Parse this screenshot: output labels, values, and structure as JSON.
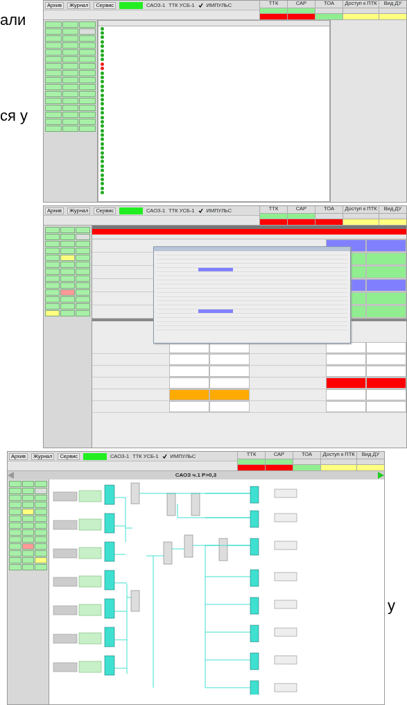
{
  "page_text": [
    "али",
    "ся у",
    "у"
  ],
  "screens": [
    {
      "kind": "table",
      "header": {
        "menu": [
          "Архив",
          "Журнал",
          "Сервис"
        ],
        "unit": "САОЗ-1",
        "device": "ТТК УСБ-1",
        "signal": "ИМПУЛЬС",
        "statuses": [
          {
            "title": "ТТК",
            "cells": [
              {
                "color": "#90ee90"
              },
              {
                "color": "#ff0000"
              }
            ]
          },
          {
            "title": "САР",
            "cells": [
              {
                "color": "#90ee90"
              },
              {
                "color": "#ff0000"
              }
            ]
          },
          {
            "title": "ТОА",
            "cells": [
              {
                "color": "#90ee90"
              }
            ]
          },
          {
            "title": "Доступ к ПТК",
            "cells": [
              {
                "color": "#ffff80"
              }
            ]
          },
          {
            "title": "Вид ДУ",
            "cells": [
              {
                "color": "#ffff80"
              }
            ]
          }
        ]
      },
      "buttons": [
        {
          "color": "#a8f0a8"
        },
        {
          "color": "#a8f0a8"
        },
        {
          "color": "#a8f0a8"
        },
        {
          "color": "#a8f0a8"
        },
        {
          "color": "#a8f0a8"
        },
        {
          "color": "#dddddd"
        },
        {
          "color": "#a8f0a8"
        },
        {
          "color": "#a8f0a8"
        },
        {
          "color": "#a8f0a8"
        },
        {
          "color": "#a8f0a8"
        },
        {
          "color": "#a8f0a8"
        },
        {
          "color": "#a8f0a8"
        },
        {
          "color": "#a8f0a8"
        },
        {
          "color": "#a8f0a8"
        },
        {
          "color": "#a8f0a8"
        },
        {
          "color": "#a8f0a8"
        },
        {
          "color": "#a8f0a8"
        },
        {
          "color": "#a8f0a8"
        },
        {
          "color": "#a8f0a8"
        },
        {
          "color": "#a8f0a8"
        },
        {
          "color": "#a8f0a8"
        },
        {
          "color": "#a8f0a8"
        },
        {
          "color": "#a8f0a8"
        },
        {
          "color": "#a8f0a8"
        },
        {
          "color": "#a8f0a8"
        },
        {
          "color": "#a8f0a8"
        },
        {
          "color": "#a8f0a8"
        },
        {
          "color": "#a8f0a8"
        },
        {
          "color": "#a8f0a8"
        },
        {
          "color": "#a8f0a8"
        },
        {
          "color": "#a8f0a8"
        },
        {
          "color": "#a8f0a8"
        },
        {
          "color": "#a8f0a8"
        },
        {
          "color": "#a8f0a8"
        },
        {
          "color": "#a8f0a8"
        },
        {
          "color": "#a8f0a8"
        },
        {
          "color": "#a8f0a8"
        },
        {
          "color": "#a8f0a8"
        },
        {
          "color": "#a8f0a8"
        },
        {
          "color": "#a8f0a8"
        },
        {
          "color": "#a8f0a8"
        },
        {
          "color": "#a8f0a8"
        },
        {
          "color": "#a8f0a8"
        },
        {
          "color": "#a8f0a8"
        },
        {
          "color": "#a8f0a8"
        },
        {
          "color": "#a8f0a8"
        },
        {
          "color": "#a8f0a8"
        },
        {
          "color": "#a8f0a8"
        }
      ],
      "rows": [
        {
          "color": "#22aa22"
        },
        {
          "color": "#22aa22"
        },
        {
          "color": "#22aa22"
        },
        {
          "color": "#22aa22"
        },
        {
          "color": "#22aa22"
        },
        {
          "color": "#22aa22"
        },
        {
          "color": "#22aa22"
        },
        {
          "color": "#22aa22"
        },
        {
          "color": "#ee2222"
        },
        {
          "color": "#ee2222"
        },
        {
          "color": "#22aa22"
        },
        {
          "color": "#22aa22"
        },
        {
          "color": "#22aa22"
        },
        {
          "color": "#22aa22"
        },
        {
          "color": "#22aa22"
        },
        {
          "color": "#22aa22"
        },
        {
          "color": "#22aa22"
        },
        {
          "color": "#22aa22"
        },
        {
          "color": "#22aa22"
        },
        {
          "color": "#22aa22"
        },
        {
          "color": "#22aa22"
        },
        {
          "color": "#22aa22"
        },
        {
          "color": "#22aa22"
        },
        {
          "color": "#22aa22"
        },
        {
          "color": "#22aa22"
        },
        {
          "color": "#22aa22"
        },
        {
          "color": "#22aa22"
        },
        {
          "color": "#22aa22"
        },
        {
          "color": "#22aa22"
        },
        {
          "color": "#22aa22"
        },
        {
          "color": "#22aa22"
        },
        {
          "color": "#22aa22"
        },
        {
          "color": "#22aa22"
        },
        {
          "color": "#22aa22"
        },
        {
          "color": "#22aa22"
        },
        {
          "color": "#22aa22"
        },
        {
          "color": "#22aa22"
        },
        {
          "color": "#22aa22"
        }
      ]
    },
    {
      "kind": "form",
      "header": {
        "menu": [
          "Архив",
          "Журнал",
          "Сервис"
        ],
        "unit": "САОЗ-1",
        "device": "ТТК УСБ-1",
        "signal": "ИМПУЛЬС",
        "statuses": [
          {
            "title": "ТТК",
            "cells": [
              {
                "color": "#90ee90"
              },
              {
                "color": "#ff0000"
              }
            ]
          },
          {
            "title": "САР",
            "cells": [
              {
                "color": "#90ee90"
              },
              {
                "color": "#ff0000"
              }
            ]
          },
          {
            "title": "ТОА",
            "cells": [
              {
                "color": "#ff0000"
              }
            ]
          },
          {
            "title": "Доступ к ПТК",
            "cells": [
              {
                "color": "#ffff80"
              }
            ]
          },
          {
            "title": "Вид ДУ",
            "cells": [
              {
                "color": "#ffff80"
              }
            ]
          }
        ]
      },
      "buttons": [
        {
          "color": "#a8f0a8"
        },
        {
          "color": "#a8f0a8"
        },
        {
          "color": "#a8f0a8"
        },
        {
          "color": "#a8f0a8"
        },
        {
          "color": "#a8f0a8"
        },
        {
          "color": "#dddddd"
        },
        {
          "color": "#a8f0a8"
        },
        {
          "color": "#a8f0a8"
        },
        {
          "color": "#a8f0a8"
        },
        {
          "color": "#a8f0a8"
        },
        {
          "color": "#a8f0a8"
        },
        {
          "color": "#a8f0a8"
        },
        {
          "color": "#a8f0a8"
        },
        {
          "color": "#ffff80"
        },
        {
          "color": "#a8f0a8"
        },
        {
          "color": "#a8f0a8"
        },
        {
          "color": "#a8f0a8"
        },
        {
          "color": "#a8f0a8"
        },
        {
          "color": "#a8f0a8"
        },
        {
          "color": "#a8f0a8"
        },
        {
          "color": "#a8f0a8"
        },
        {
          "color": "#a8f0a8"
        },
        {
          "color": "#a8f0a8"
        },
        {
          "color": "#a8f0a8"
        },
        {
          "color": "#a8f0a8"
        },
        {
          "color": "#a8f0a8"
        },
        {
          "color": "#a8f0a8"
        },
        {
          "color": "#a8f0a8"
        },
        {
          "color": "#ff9999"
        },
        {
          "color": "#a8f0a8"
        },
        {
          "color": "#a8f0a8"
        },
        {
          "color": "#a8f0a8"
        },
        {
          "color": "#a8f0a8"
        },
        {
          "color": "#a8f0a8"
        },
        {
          "color": "#a8f0a8"
        },
        {
          "color": "#a8f0a8"
        },
        {
          "color": "#ffff80"
        },
        {
          "color": "#a8f0a8"
        },
        {
          "color": "#a8f0a8"
        }
      ],
      "alarm": {
        "color": "#ff0000"
      },
      "top_rows": [
        {
          "cells": [
            {
              "color": "#8080ff"
            },
            {
              "color": "#8080ff"
            }
          ]
        },
        {
          "cells": [
            {
              "color": "#90ee90"
            },
            {
              "color": "#90ee90"
            }
          ]
        },
        {
          "cells": [
            {
              "color": "#90ee90"
            },
            {
              "color": "#90ee90"
            }
          ]
        },
        {
          "cells": [
            {
              "color": "#8080ff"
            },
            {
              "color": "#8080ff"
            }
          ]
        },
        {
          "cells": [
            {
              "color": "#90ee90"
            },
            {
              "color": "#90ee90"
            }
          ]
        },
        {
          "cells": [
            {
              "color": "#90ee90"
            },
            {
              "color": "#90ee90"
            }
          ]
        }
      ],
      "bottom_rows": [
        {
          "cells": [
            {
              "color": "#ffffff"
            },
            {
              "color": "#ffffff"
            },
            {
              "color": "#ffffff"
            },
            {
              "color": "#ffffff"
            }
          ]
        },
        {
          "cells": [
            {
              "color": "#ffffff"
            },
            {
              "color": "#ffffff"
            },
            {
              "color": "#ffffff"
            },
            {
              "color": "#ffffff"
            }
          ]
        },
        {
          "cells": [
            {
              "color": "#ffffff"
            },
            {
              "color": "#ffffff"
            },
            {
              "color": "#ffffff"
            },
            {
              "color": "#ffffff"
            }
          ]
        },
        {
          "cells": [
            {
              "color": "#ffffff"
            },
            {
              "color": "#ffffff"
            },
            {
              "color": "#ff0000"
            },
            {
              "color": "#ff0000"
            }
          ]
        },
        {
          "cells": [
            {
              "color": "#ffaa00"
            },
            {
              "color": "#ffaa00"
            },
            {
              "color": "#ffffff"
            },
            {
              "color": "#ffffff"
            }
          ]
        },
        {
          "cells": [
            {
              "color": "#ffffff"
            },
            {
              "color": "#ffffff"
            },
            {
              "color": "#ffffff"
            },
            {
              "color": "#ffffff"
            }
          ]
        }
      ]
    },
    {
      "kind": "diagram",
      "header": {
        "menu": [
          "Архив",
          "Журнал",
          "Сервис"
        ],
        "unit": "САОЗ-1",
        "device": "ТТК УСБ-1",
        "signal": "ИМПУЛЬС",
        "statuses": [
          {
            "title": "ТТК",
            "cells": [
              {
                "color": "#90ee90"
              },
              {
                "color": "#ff0000"
              }
            ]
          },
          {
            "title": "САР",
            "cells": [
              {
                "color": "#90ee90"
              },
              {
                "color": "#ff0000"
              }
            ]
          },
          {
            "title": "ТОА",
            "cells": [
              {
                "color": "#90ee90"
              }
            ]
          },
          {
            "title": "Доступ к ПТК",
            "cells": [
              {
                "color": "#ffff80"
              }
            ]
          },
          {
            "title": "Вид ДУ",
            "cells": [
              {
                "color": "#ffff80"
              }
            ]
          }
        ]
      },
      "title": "САОЗ ч.1 Р>0,3",
      "buttons": [
        {
          "color": "#a8f0a8"
        },
        {
          "color": "#a8f0a8"
        },
        {
          "color": "#a8f0a8"
        },
        {
          "color": "#a8f0a8"
        },
        {
          "color": "#a8f0a8"
        },
        {
          "color": "#dddddd"
        },
        {
          "color": "#a8f0a8"
        },
        {
          "color": "#a8f0a8"
        },
        {
          "color": "#a8f0a8"
        },
        {
          "color": "#a8f0a8"
        },
        {
          "color": "#a8f0a8"
        },
        {
          "color": "#a8f0a8"
        },
        {
          "color": "#a8f0a8"
        },
        {
          "color": "#ffff80"
        },
        {
          "color": "#a8f0a8"
        },
        {
          "color": "#a8f0a8"
        },
        {
          "color": "#a8f0a8"
        },
        {
          "color": "#a8f0a8"
        },
        {
          "color": "#a8f0a8"
        },
        {
          "color": "#a8f0a8"
        },
        {
          "color": "#a8f0a8"
        },
        {
          "color": "#a8f0a8"
        },
        {
          "color": "#a8f0a8"
        },
        {
          "color": "#a8f0a8"
        },
        {
          "color": "#a8f0a8"
        },
        {
          "color": "#a8f0a8"
        },
        {
          "color": "#a8f0a8"
        },
        {
          "color": "#a8f0a8"
        },
        {
          "color": "#ff9999"
        },
        {
          "color": "#a8f0a8"
        },
        {
          "color": "#a8f0a8"
        },
        {
          "color": "#a8f0a8"
        },
        {
          "color": "#a8f0a8"
        },
        {
          "color": "#a8f0a8"
        },
        {
          "color": "#a8f0a8"
        },
        {
          "color": "#ffff80"
        },
        {
          "color": "#a8f0a8"
        },
        {
          "color": "#a8f0a8"
        },
        {
          "color": "#a8f0a8"
        }
      ]
    }
  ]
}
